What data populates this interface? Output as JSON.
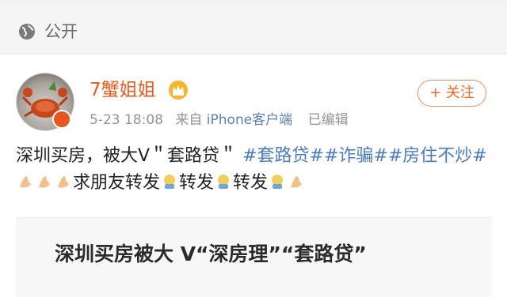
{
  "visibility": {
    "label": "公开",
    "icon": "globe-icon"
  },
  "post": {
    "author": {
      "name": "7蟹姐姐",
      "badge_icon": "crown-icon",
      "verified_icon": "verified-badge-icon"
    },
    "follow_label": "+ 关注",
    "meta": {
      "date": "5-23 18:08",
      "source_prefix": "来自",
      "source": "iPhone客户端",
      "edited": "已编辑"
    },
    "text": {
      "plain_1": "深圳买房，被大V＂套路贷＂",
      "tag_1": "#套路贷#",
      "tag_2": "#诈骗#",
      "tag_3": "#房住不炒#",
      "plain_2": "求朋友转发",
      "plain_3": "转发",
      "plain_4": "转发"
    },
    "card": {
      "title": "深圳买房被大 V“深房理”“套路贷”"
    }
  },
  "colors": {
    "accent_orange": "#f05a1e",
    "link_blue": "#4a7bc0",
    "meta_gray": "#939393"
  }
}
